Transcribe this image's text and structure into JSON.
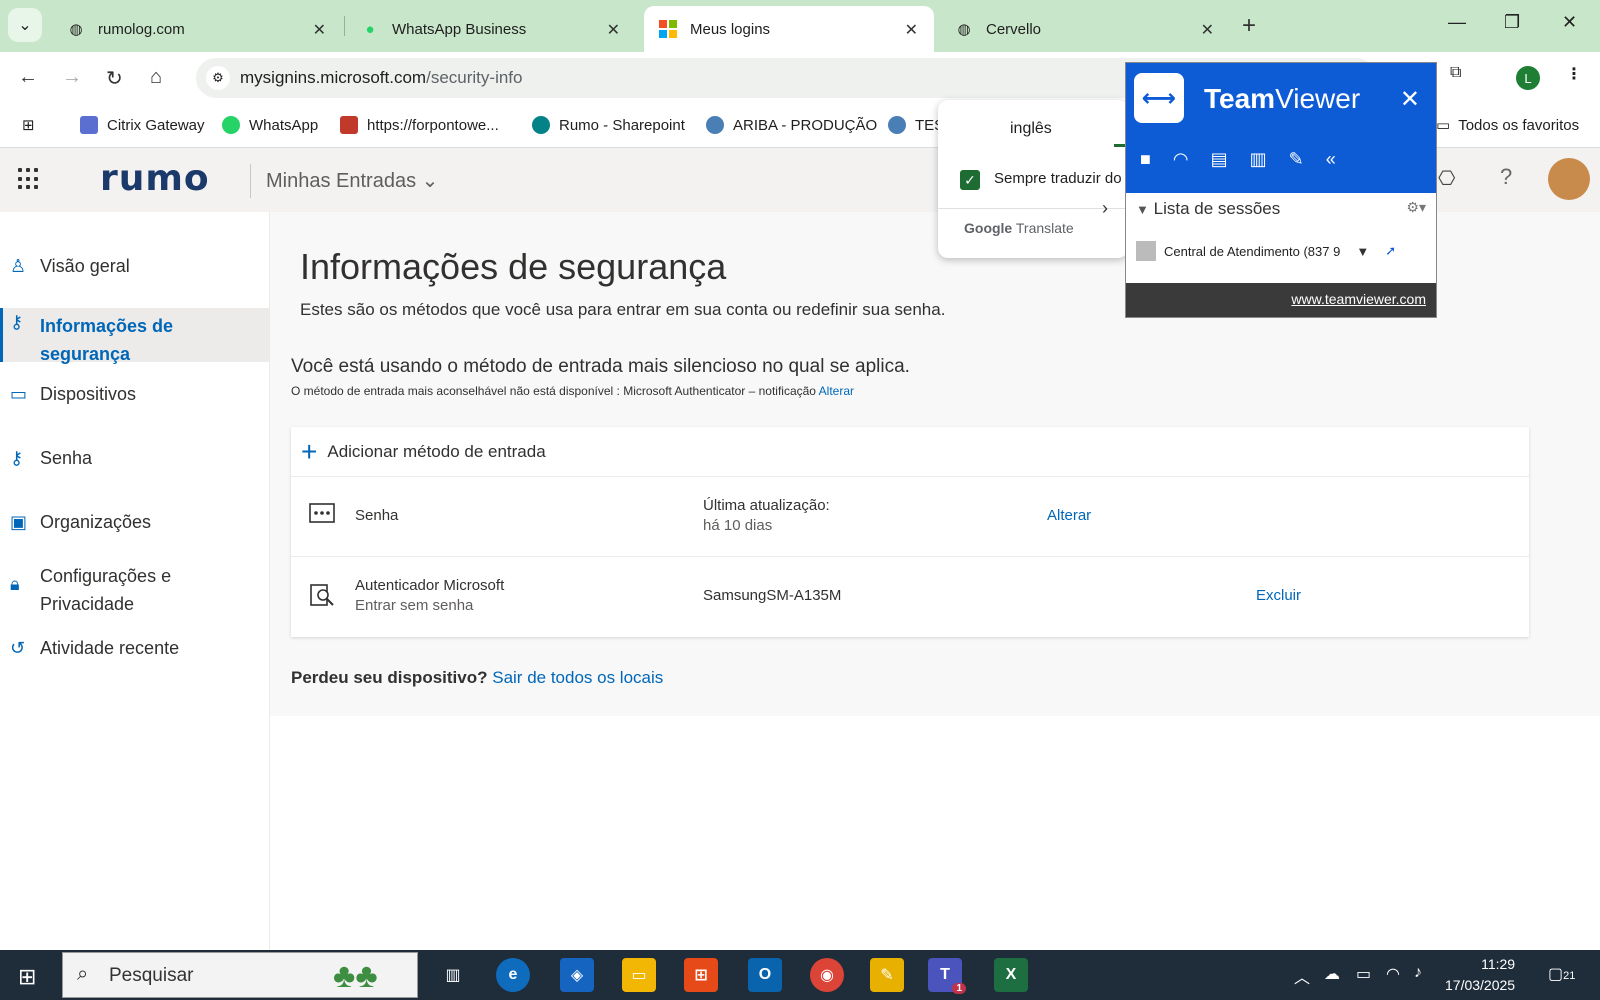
{
  "browser": {
    "tabs": [
      {
        "label": "rumolog.com",
        "icon": "globe-icon"
      },
      {
        "label": "WhatsApp Business",
        "icon": "whatsapp-icon"
      },
      {
        "label": "Meus logins",
        "icon": "microsoft-icon",
        "active": true
      },
      {
        "label": "Cervello",
        "icon": "globe-icon"
      }
    ],
    "url_host": "mysignins.microsoft.com",
    "url_path": "/security-info",
    "profile_initial": "L",
    "bookmarks": [
      {
        "label": "Citrix Gateway"
      },
      {
        "label": "WhatsApp"
      },
      {
        "label": "https://forpontowe..."
      },
      {
        "label": "Rumo - Sharepoint"
      },
      {
        "label": "ARIBA - PRODUÇÃO"
      },
      {
        "label": "TES"
      }
    ],
    "all_favorites": "Todos os favoritos"
  },
  "app": {
    "logo": "rumo",
    "title": "Minhas Entradas"
  },
  "nav": {
    "items": [
      {
        "label": "Visão geral"
      },
      {
        "label": "Informações de segurança"
      },
      {
        "label": "Dispositivos"
      },
      {
        "label": "Senha"
      },
      {
        "label": "Organizações"
      },
      {
        "label": "Configurações e Privacidade"
      },
      {
        "label": "Atividade recente"
      }
    ]
  },
  "main": {
    "title": "Informações de segurança",
    "subtitle": "Estes são os métodos que você usa para entrar em sua conta ou redefinir sua senha.",
    "default_heading": "Você está usando o método de entrada mais silencioso no qual se aplica.",
    "note_text": "O método de entrada mais aconselhável não está disponível : Microsoft Authenticator – notificação",
    "note_link": "Alterar",
    "add_method": "Adicionar método de entrada",
    "methods": [
      {
        "name": "Senha",
        "sub": "",
        "col2": "Última atualização:",
        "col2b": "há 10 dias",
        "action": "Alterar"
      },
      {
        "name": "Autenticador Microsoft",
        "sub": "Entrar sem senha",
        "col2": "SamsungSM-A135M",
        "col2b": "",
        "action": "Excluir"
      }
    ],
    "lost_prefix": "Perdeu seu dispositivo?",
    "lost_link": "Sair de todos os locais"
  },
  "translate": {
    "language": "inglês",
    "always_label": "Sempre traduzir do",
    "always_checked": true,
    "brand_google": "Google",
    "brand_translate": "Translate"
  },
  "teamviewer": {
    "title_bold": "Team",
    "title_rest": "Viewer",
    "sessions_label": "Lista de sessões",
    "session_item": "Central de Atendimento (837 9",
    "footer_link": "www.teamviewer.com"
  },
  "taskbar": {
    "search_placeholder": "Pesquisar",
    "time": "11:29",
    "date": "17/03/2025",
    "notification_count": "21",
    "teams_badge": "1"
  },
  "colors": {
    "accent": "#0067b8",
    "tabstrip": "#c8e6c9",
    "teamviewer_blue": "#0e5bd6",
    "taskbar": "#1f2c3a"
  }
}
